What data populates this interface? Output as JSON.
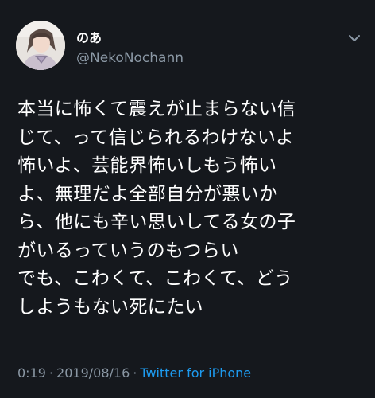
{
  "user": {
    "display_name": "のあ",
    "handle": "@NekoNochann"
  },
  "icons": {
    "avatar": "avatar-photo",
    "menu": "chevron-down-icon"
  },
  "tweet": {
    "lines": [
      "本当に怖くて震えが止まらない信",
      "じて、って信じられるわけないよ",
      "怖いよ、芸能界怖いしもう怖い",
      "よ、無理だよ全部自分が悪いか",
      "ら、他にも辛い思いしてる女の子",
      "がいるっていうのもつらい",
      "でも、こわくて、こわくて、どう",
      "しようもない死にたい"
    ]
  },
  "meta": {
    "time": "0:19",
    "separator1": "·",
    "date": "2019/08/16",
    "separator2": "·",
    "source": "Twitter for iPhone"
  },
  "colors": {
    "background": "#15181d",
    "text": "#ffffff",
    "secondary": "#8b98a5",
    "link": "#1d9bf0"
  }
}
